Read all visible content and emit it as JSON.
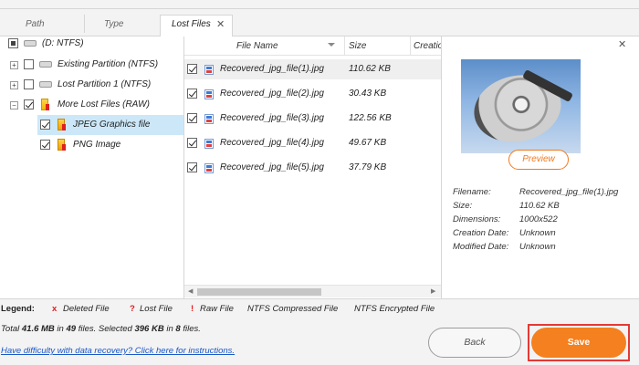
{
  "tabs": [
    {
      "label": "Path"
    },
    {
      "label": "Type"
    },
    {
      "label": "Lost Files",
      "close": "✕"
    }
  ],
  "tree": [
    {
      "label": "(D: NTFS)",
      "checkbox": "partial"
    },
    {
      "label": "Existing Partition (NTFS)",
      "checkbox": "unchecked"
    },
    {
      "label": "Lost Partition 1 (NTFS)",
      "checkbox": "unchecked"
    },
    {
      "label": "More Lost Files (RAW)",
      "checkbox": "checked"
    },
    {
      "label": "JPEG Graphics file",
      "checkbox": "checked",
      "selected": true
    },
    {
      "label": "PNG Image",
      "checkbox": "checked"
    }
  ],
  "list": {
    "columns": {
      "name": "File Name",
      "size": "Size",
      "created": "Creatio"
    },
    "rows": [
      {
        "name": "Recovered_jpg_file(1).jpg",
        "size": "110.62 KB",
        "checked": true
      },
      {
        "name": "Recovered_jpg_file(2).jpg",
        "size": "30.43 KB",
        "checked": true
      },
      {
        "name": "Recovered_jpg_file(3).jpg",
        "size": "122.56 KB",
        "checked": true
      },
      {
        "name": "Recovered_jpg_file(4).jpg",
        "size": "49.67 KB",
        "checked": true
      },
      {
        "name": "Recovered_jpg_file(5).jpg",
        "size": "37.79 KB",
        "checked": true
      }
    ]
  },
  "preview": {
    "close": "✕",
    "button": "Preview",
    "fields": [
      {
        "key": "Filename:",
        "value": "Recovered_jpg_file(1).jpg"
      },
      {
        "key": "Size:",
        "value": "110.62 KB"
      },
      {
        "key": "Dimensions:",
        "value": "1000x522"
      },
      {
        "key": "Creation Date:",
        "value": "Unknown"
      },
      {
        "key": "Modified Date:",
        "value": "Unknown"
      }
    ]
  },
  "legend": {
    "title": "Legend:",
    "deleted_mark": "x",
    "deleted": "Deleted File",
    "lost_mark": "?",
    "lost": "Lost File",
    "raw_mark": "!",
    "raw": "Raw File",
    "compressed": "NTFS Compressed File",
    "encrypted": "NTFS Encrypted File"
  },
  "status": {
    "p1": "Total ",
    "total": "41.6 MB",
    "p2": " in ",
    "files": "49",
    "p3": " files.  Selected ",
    "selected": "396 KB",
    "p4": " in ",
    "selected_files": "8",
    "p5": " files."
  },
  "help_link": "Have difficulty with data recovery? Click here for instructions.",
  "buttons": {
    "back": "Back",
    "save": "Save"
  },
  "colors": {
    "accent": "#f4801f",
    "highlight_border": "#e53935",
    "link": "#1a57c7",
    "tree_selection": "#cce8f8"
  }
}
